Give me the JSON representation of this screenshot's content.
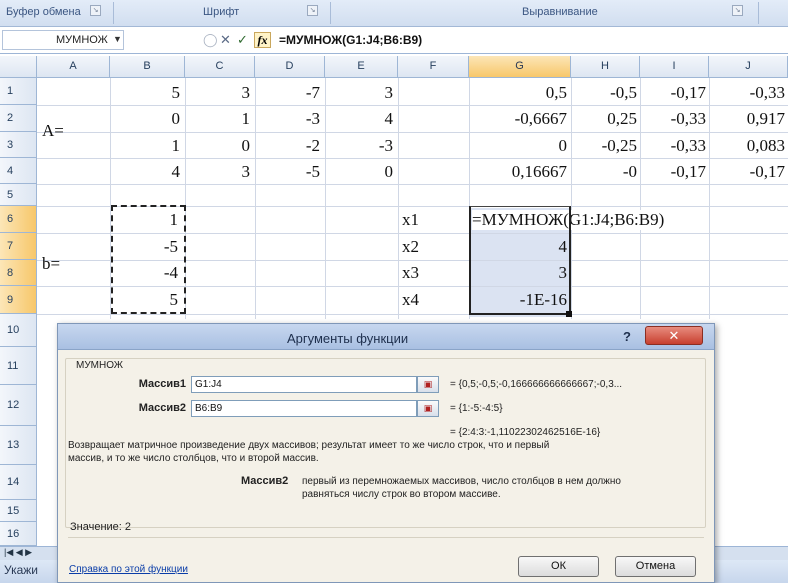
{
  "ribbon": {
    "groups": [
      {
        "label": "Буфер обмена"
      },
      {
        "label": "Шрифт"
      },
      {
        "label": "Выравнивание"
      }
    ]
  },
  "formula_bar": {
    "name_box": "МУМНОЖ",
    "formula": "=МУМНОЖ(G1:J4;B6:B9)",
    "fx_label": "fx",
    "cancel_glyph": "✕",
    "enter_glyph": "✓"
  },
  "columns": [
    "A",
    "B",
    "C",
    "D",
    "E",
    "F",
    "G",
    "H",
    "I",
    "J"
  ],
  "rows": [
    "1",
    "2",
    "3",
    "4",
    "5",
    "6",
    "7",
    "8",
    "9",
    "10",
    "11",
    "12",
    "13",
    "14",
    "15",
    "16"
  ],
  "cells": {
    "A_label": "A=",
    "b_label": "b=",
    "matrixA": [
      [
        "5",
        "3",
        "-7",
        "3"
      ],
      [
        "0",
        "1",
        "-3",
        "4"
      ],
      [
        "1",
        "0",
        "-2",
        "-3"
      ],
      [
        "4",
        "3",
        "-5",
        "0"
      ]
    ],
    "inverse": [
      [
        "0,5",
        "-0,5",
        "-0,17",
        "-0,33"
      ],
      [
        "-0,6667",
        "0,25",
        "-0,33",
        "0,917"
      ],
      [
        "0",
        "-0,25",
        "-0,33",
        "0,083"
      ],
      [
        "0,16667",
        "-0",
        "-0,17",
        "-0,17"
      ]
    ],
    "vector_b": [
      "1",
      "-5",
      "-4",
      "5"
    ],
    "x_labels": [
      "x1",
      "x2",
      "x3",
      "x4"
    ],
    "results": [
      "=МУМНОЖ(G1:J4;B6:B9)",
      "4",
      "3",
      "-1E-16"
    ]
  },
  "dialog": {
    "title": "Аргументы функции",
    "help": "?",
    "close": "✕",
    "function_name": "МУМНОЖ",
    "arg1": {
      "label": "Массив1",
      "value": "G1:J4",
      "result": "=  {0,5;-0,5;-0,166666666666667;-0,3..."
    },
    "arg2": {
      "label": "Массив2",
      "value": "B6:B9",
      "result": "=  {1:-5:-4:5}"
    },
    "formula_result": "=  {2:4:3:-1,11022302462516E-16}",
    "description_line1": "Возвращает матричное произведение двух массивов; результат имеет то же число строк, что и первый",
    "description_line2": "массив, и то же число столбцов, что и второй массив.",
    "arg_help_label": "Массив2",
    "arg_help_line1": "первый из перемножаемых массивов, число столбцов в нем должно",
    "arg_help_line2": "равняться числу строк во втором массиве.",
    "value_label": "Значение:  2",
    "help_link": "Справка по этой функции",
    "ok": "ОК",
    "cancel": "Отмена"
  },
  "status": {
    "text": "Укажи"
  }
}
